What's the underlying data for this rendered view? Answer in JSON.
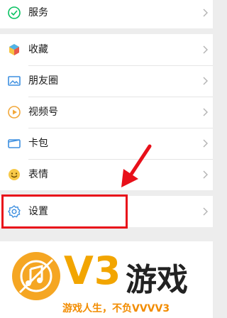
{
  "menu": {
    "services_label": "服务",
    "favorites_label": "收藏",
    "moments_label": "朋友圈",
    "channels_label": "视频号",
    "cards_label": "卡包",
    "stickers_label": "表情",
    "settings_label": "设置"
  },
  "banner": {
    "brand_v3": "V3",
    "brand_cn": "游戏",
    "slogan": "游戏人生，不负VVVV3"
  },
  "colors": {
    "highlight": "#e8101a",
    "arrow": "#e8101a",
    "brand_orange": "#f2a500"
  }
}
